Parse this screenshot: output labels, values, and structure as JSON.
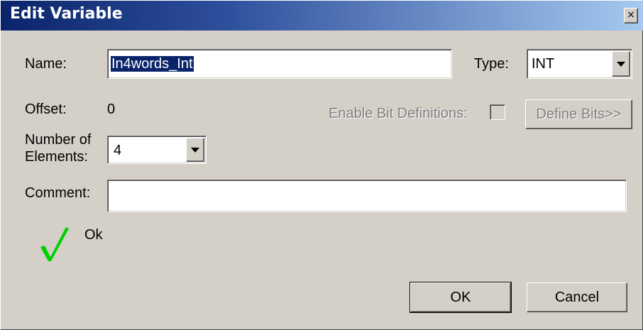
{
  "window": {
    "title": "Edit Variable",
    "close_glyph": "×"
  },
  "fields": {
    "name_label": "Name:",
    "name_value": "In4words_Int",
    "type_label": "Type:",
    "type_value": "INT",
    "offset_label": "Offset:",
    "offset_value": "0",
    "enable_bits_label": "Enable Bit Definitions:",
    "enable_bits_checked": false,
    "define_bits_label": "Define Bits>>",
    "elements_label_line1": "Number of",
    "elements_label_line2": "Elements:",
    "elements_value": "4",
    "comment_label": "Comment:",
    "comment_value": ""
  },
  "status": {
    "icon": "checkmark-icon",
    "text": "Ok",
    "color": "#00cc00"
  },
  "buttons": {
    "ok_label": "OK",
    "cancel_label": "Cancel"
  },
  "colors": {
    "titlebar_start": "#0a246a",
    "titlebar_end": "#a6caf0",
    "face": "#d4d0c8",
    "selection": "#0a246a"
  }
}
